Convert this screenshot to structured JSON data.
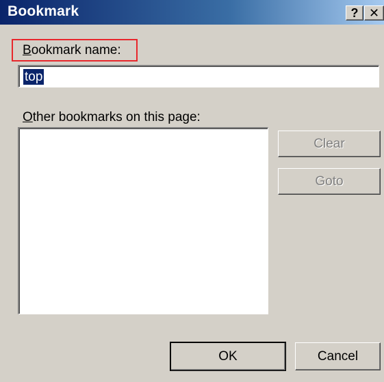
{
  "window": {
    "title": "Bookmark",
    "help_label": "?",
    "close_label": "✕"
  },
  "form": {
    "name_label_mnemonic": "B",
    "name_label_rest": "ookmark name:",
    "name_value": "top",
    "other_label_mnemonic": "O",
    "other_label_rest": "ther bookmarks on this page:",
    "bookmarks": []
  },
  "buttons": {
    "clear": "Clear",
    "goto": "Goto",
    "ok": "OK",
    "cancel": "Cancel"
  },
  "colors": {
    "titlebar": "#0a246a",
    "dialog_face": "#d4d0c8",
    "highlight": "#e8262b",
    "selection": "#0a246a"
  }
}
